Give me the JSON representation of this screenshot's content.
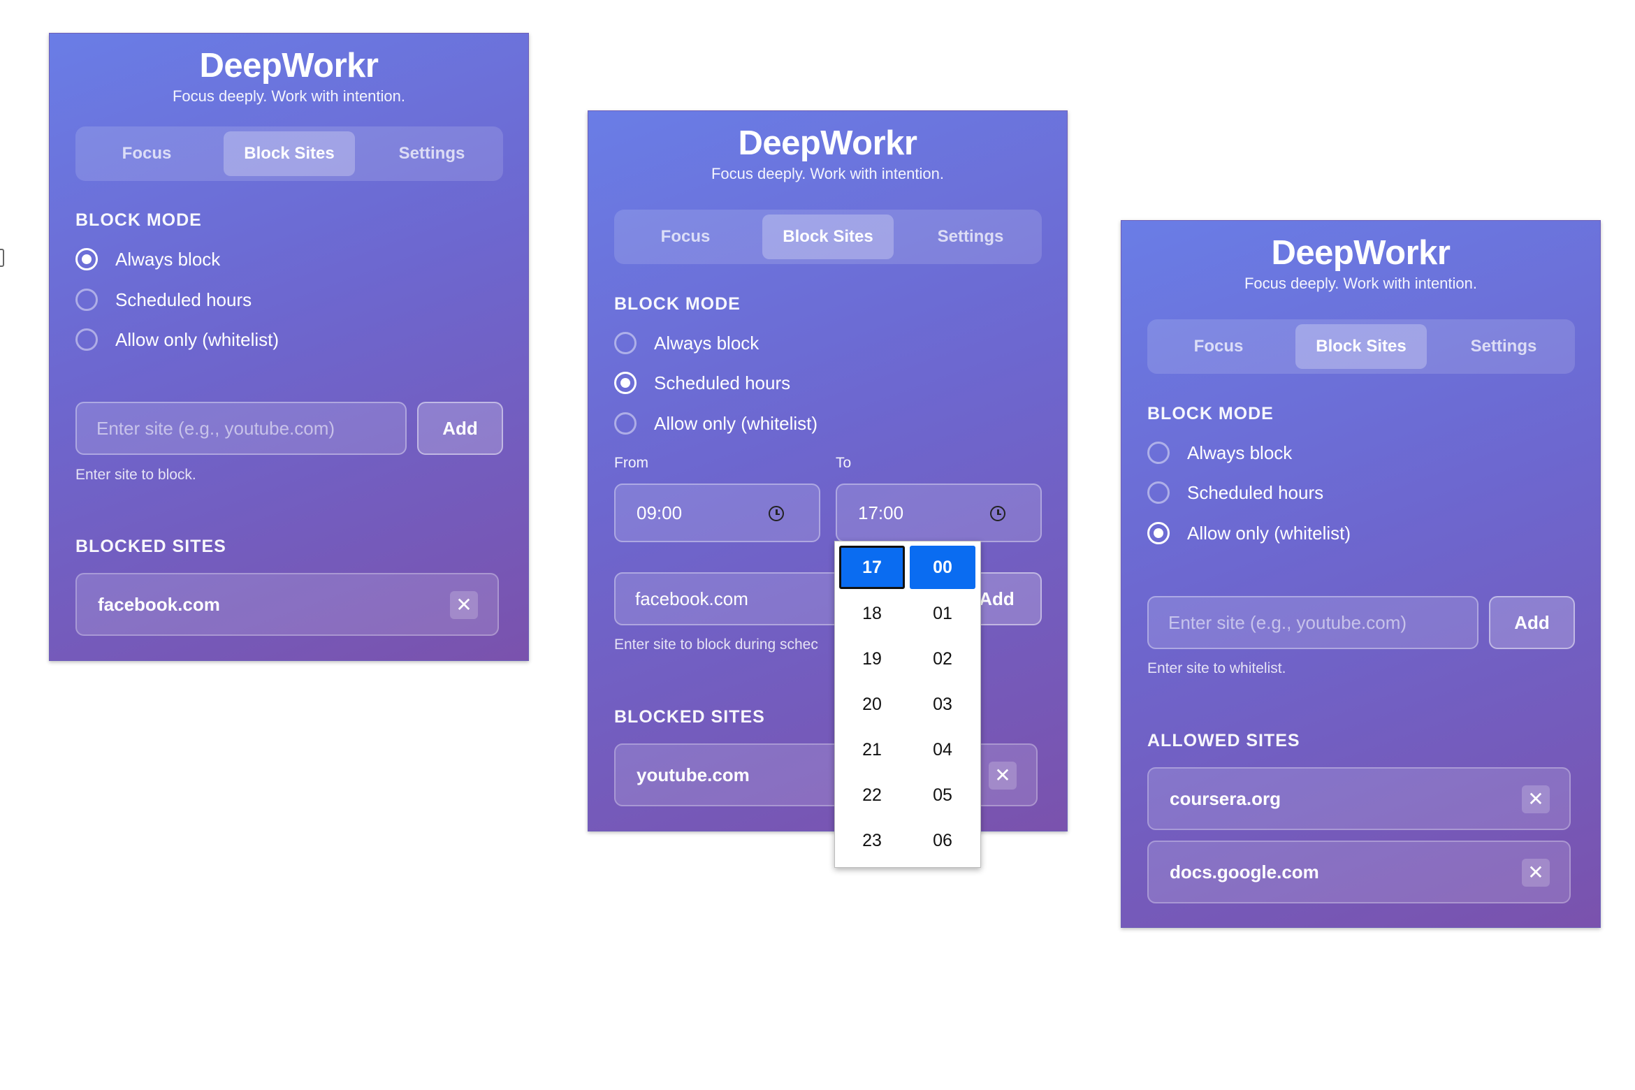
{
  "app": {
    "name": "DeepWorkr",
    "tagline": "Focus deeply. Work with intention.",
    "tabs": [
      "Focus",
      "Block Sites",
      "Settings"
    ]
  },
  "block_mode_label": "BLOCK MODE",
  "modes": [
    "Always block",
    "Scheduled hours",
    "Allow only (whitelist)"
  ],
  "input_placeholder": "Enter site (e.g., youtube.com)",
  "add_label": "Add",
  "panels": [
    {
      "selected_mode": "Always block",
      "hint": "Enter site to block.",
      "list_label": "BLOCKED SITES",
      "sites": [
        "facebook.com"
      ]
    },
    {
      "selected_mode": "Scheduled hours",
      "from_label": "From",
      "to_label": "To",
      "from_time": "09:00",
      "to_time": "17:00",
      "input_value": "facebook.com",
      "hint": "Enter site to block during schec",
      "list_label": "BLOCKED SITES",
      "sites": [
        "youtube.com"
      ],
      "time_picker": {
        "hours": [
          "17",
          "18",
          "19",
          "20",
          "21",
          "22",
          "23"
        ],
        "minutes": [
          "00",
          "01",
          "02",
          "03",
          "04",
          "05",
          "06"
        ],
        "selected_hour": "17",
        "selected_minute": "00"
      }
    },
    {
      "selected_mode": "Allow only (whitelist)",
      "hint": "Enter site to whitelist.",
      "list_label": "ALLOWED SITES",
      "sites": [
        "coursera.org",
        "docs.google.com"
      ]
    }
  ],
  "icons": {
    "remove": "close-icon",
    "clock": "clock-icon"
  }
}
